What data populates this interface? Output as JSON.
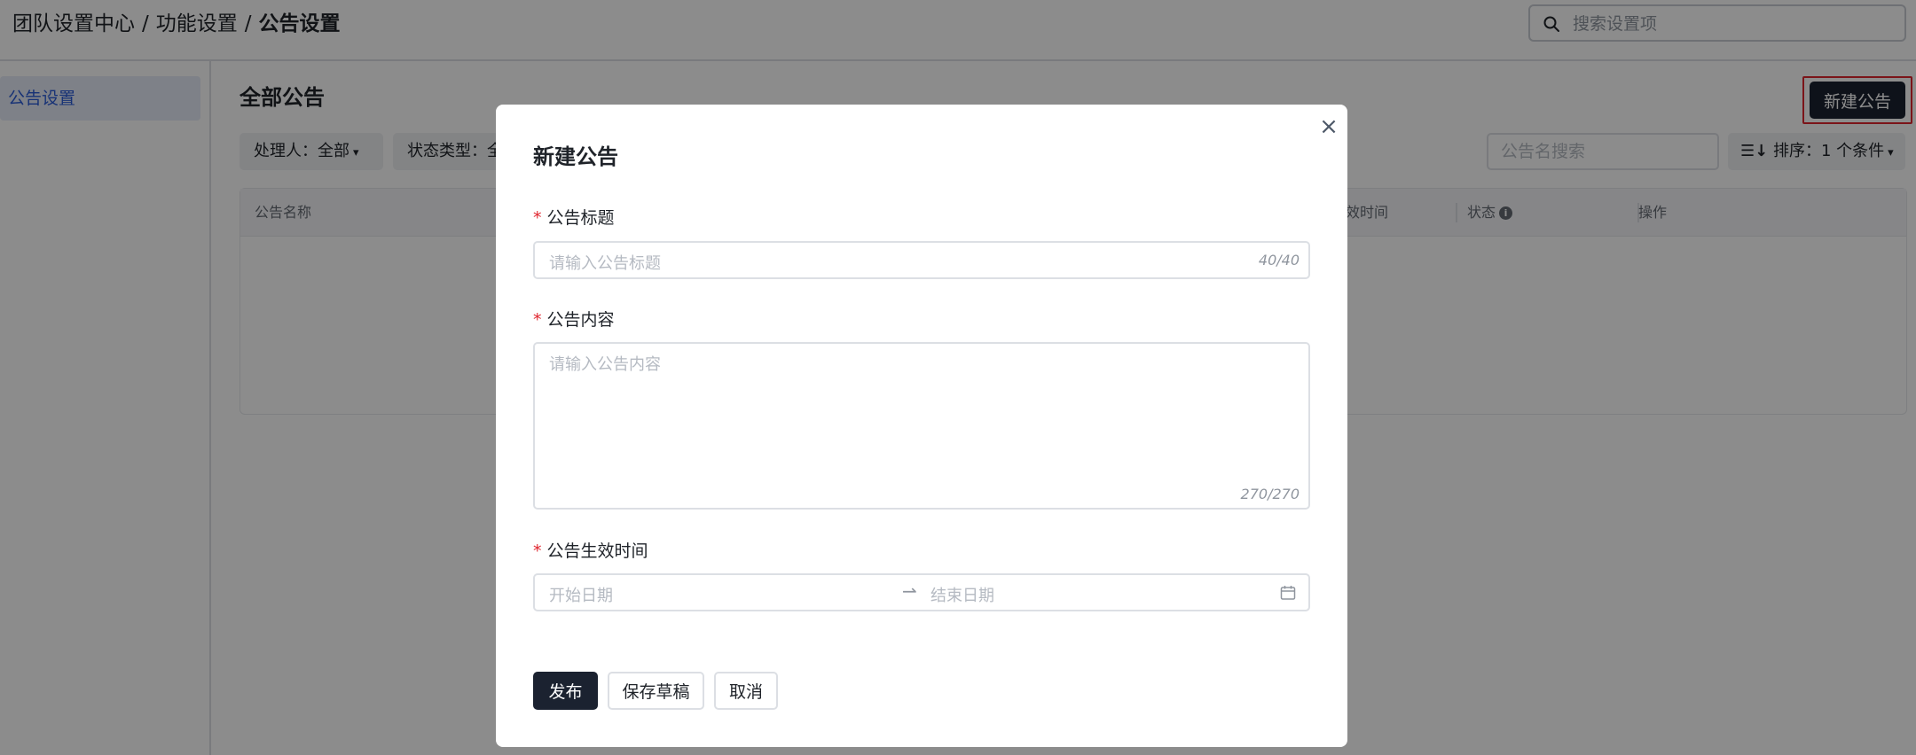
{
  "header": {
    "breadcrumb": [
      "团队设置中心",
      "功能设置",
      "公告设置"
    ],
    "breadcrumb_separator": "/",
    "search_placeholder": "搜索设置项"
  },
  "sidebar": {
    "items": [
      {
        "label": "公告设置",
        "active": true
      }
    ]
  },
  "main": {
    "title": "全部公告",
    "new_button_label": "新建公告",
    "filters": [
      {
        "label": "处理人：全部"
      },
      {
        "label": "状态类型：全部"
      }
    ],
    "list_search_placeholder": "公告名搜索",
    "sort_label": "排序：1 个条件",
    "table_headers": [
      "公告名称",
      "生效时间",
      "状态",
      "操作"
    ]
  },
  "modal": {
    "title": "新建公告",
    "close_icon": "close-icon",
    "fields": {
      "title": {
        "label": "公告标题",
        "placeholder": "请输入公告标题",
        "counter": "40/40",
        "value": ""
      },
      "content": {
        "label": "公告内容",
        "placeholder": "请输入公告内容",
        "counter": "270/270",
        "value": ""
      },
      "effective_time": {
        "label": "公告生效时间",
        "start_placeholder": "开始日期",
        "end_placeholder": "结束日期",
        "separator_icon": "arrow-right-icon",
        "calendar_icon": "calendar-icon"
      }
    },
    "buttons": {
      "publish": "发布",
      "save_draft": "保存草稿",
      "cancel": "取消"
    }
  },
  "colors": {
    "primary_dark": "#1b2230",
    "accent_blue": "#2b5bd7",
    "required_red": "#e0252e",
    "highlight_red": "#e0252e"
  }
}
